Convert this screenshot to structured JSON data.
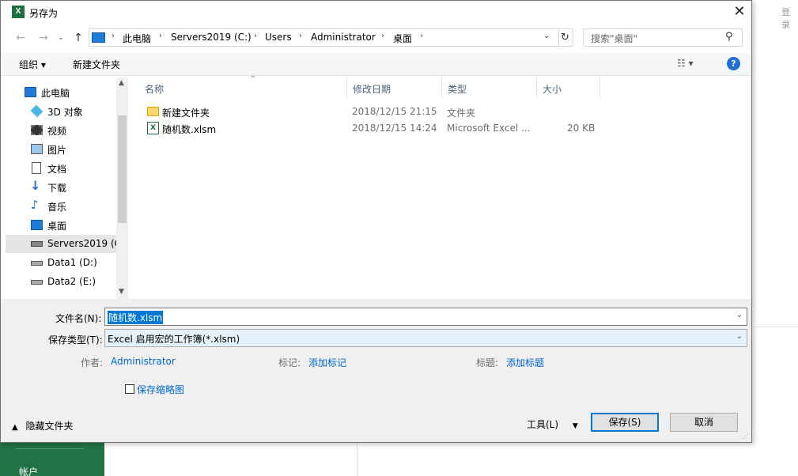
{
  "background": {
    "login": "登录",
    "account": "帐户"
  },
  "dialog": {
    "title": "另存为",
    "close": "✕"
  },
  "nav": {
    "back": "←",
    "forward": "→",
    "up": "↑",
    "breadcrumbs": [
      "此电脑",
      "Servers2019 (C:)",
      "Users",
      "Administrator",
      "桌面"
    ],
    "refresh": "↻",
    "search_placeholder": "搜索\"桌面\""
  },
  "toolbar": {
    "organize": "组织 ▾",
    "new_folder": "新建文件夹",
    "view": "☷ ▾",
    "help": "?"
  },
  "sidebar": {
    "items": [
      {
        "label": "此电脑",
        "icon": "computer-icon"
      },
      {
        "label": "3D 对象",
        "icon": "3d-objects-icon"
      },
      {
        "label": "视频",
        "icon": "videos-icon"
      },
      {
        "label": "图片",
        "icon": "pictures-icon"
      },
      {
        "label": "文档",
        "icon": "documents-icon"
      },
      {
        "label": "下载",
        "icon": "downloads-icon"
      },
      {
        "label": "音乐",
        "icon": "music-icon"
      },
      {
        "label": "桌面",
        "icon": "desktop-icon"
      },
      {
        "label": "Servers2019 (C",
        "icon": "drive-icon",
        "selected": true
      },
      {
        "label": "Data1 (D:)",
        "icon": "drive-icon"
      },
      {
        "label": "Data2 (E:)",
        "icon": "drive-icon"
      }
    ]
  },
  "filelist": {
    "columns": [
      "名称",
      "修改日期",
      "类型",
      "大小"
    ],
    "rows": [
      {
        "name": "新建文件夹",
        "date": "2018/12/15 21:15",
        "type": "文件夹",
        "size": "",
        "icon": "folder-icon"
      },
      {
        "name": "随机数.xlsm",
        "date": "2018/12/15 14:24",
        "type": "Microsoft Excel ...",
        "size": "20 KB",
        "icon": "excel-file-icon"
      }
    ]
  },
  "form": {
    "filename_label": "文件名(N):",
    "filename_value": "随机数.xlsm",
    "filetype_label": "保存类型(T):",
    "filetype_value": "Excel 启用宏的工作簿(*.xlsm)",
    "author_label": "作者:",
    "author_value": "Administrator",
    "tags_label": "标记:",
    "tags_value": "添加标记",
    "title_label": "标题:",
    "title_value": "添加标题",
    "thumbnail_label": "保存缩略图"
  },
  "footer": {
    "hide_folders": "隐藏文件夹",
    "tools": "工具(L)",
    "save": "保存(S)",
    "cancel": "取消"
  }
}
